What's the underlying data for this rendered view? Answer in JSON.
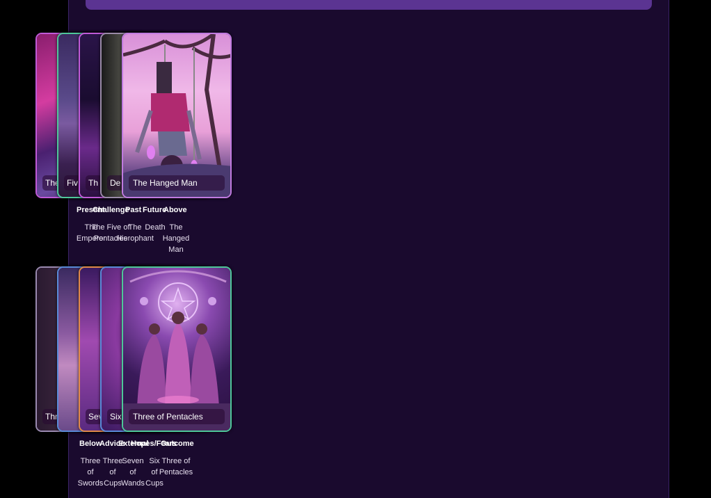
{
  "colors": {
    "panel": "#1a0a2e",
    "topbar": "#5b3492",
    "background": "#000000"
  },
  "row1": {
    "cards": [
      {
        "caption": "The",
        "art": "the-emperor"
      },
      {
        "caption": "Fiv",
        "art": "five-of-pentacles"
      },
      {
        "caption": "Th",
        "art": "the-hierophant"
      },
      {
        "caption": "De",
        "art": "death"
      },
      {
        "caption": "The Hanged Man",
        "art": "the-hanged-man"
      }
    ],
    "positions": [
      "Present",
      "Challenge",
      "Past",
      "Future",
      "Above"
    ],
    "names": [
      [
        "The",
        "Emperor"
      ],
      [
        "The Five of",
        "Pentacles"
      ],
      [
        "The",
        "Hierophant"
      ],
      [
        "Death"
      ],
      [
        "The",
        "Hanged",
        "Man"
      ]
    ]
  },
  "row2": {
    "cards": [
      {
        "caption": "Thr",
        "art": "three-of-swords"
      },
      {
        "caption": "",
        "art": "three-of-cups"
      },
      {
        "caption": "Sev",
        "art": "seven-of-wands"
      },
      {
        "caption": "Six",
        "art": "six-of-cups"
      },
      {
        "caption": "Three of Pentacles",
        "art": "three-of-pentacles"
      }
    ],
    "positions": [
      "Below",
      "Advice",
      "External",
      "Hopes/Fears",
      "Outcome"
    ],
    "names": [
      [
        "Three",
        "of",
        "Swords"
      ],
      [
        "Three",
        "of",
        "Cups"
      ],
      [
        "Seven",
        "of",
        "Wands"
      ],
      [
        "Six",
        "of",
        "Cups"
      ],
      [
        "Three of",
        "Pentacles"
      ]
    ]
  }
}
